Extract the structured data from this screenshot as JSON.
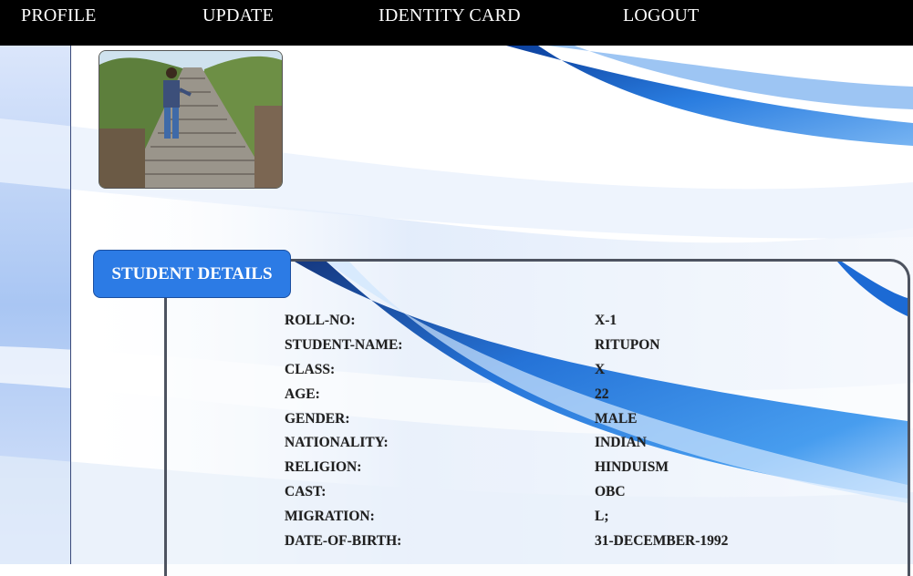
{
  "nav": {
    "profile": "PROFILE",
    "update": "UPDATE",
    "identity_card": "IDENTITY CARD",
    "logout": "LOGOUT"
  },
  "section_title": "STUDENT DETAILS",
  "details": [
    {
      "label": "ROLL-NO:",
      "value": "X-1"
    },
    {
      "label": "STUDENT-NAME:",
      "value": "RITUPON"
    },
    {
      "label": "CLASS:",
      "value": "X"
    },
    {
      "label": "AGE:",
      "value": "22"
    },
    {
      "label": "GENDER:",
      "value": "MALE"
    },
    {
      "label": "NATIONALITY:",
      "value": "INDIAN"
    },
    {
      "label": "RELIGION:",
      "value": "HINDUISM"
    },
    {
      "label": "CAST:",
      "value": "OBC"
    },
    {
      "label": "MIGRATION:",
      "value": "L;"
    },
    {
      "label": "DATE-OF-BIRTH:",
      "value": "31-DECEMBER-1992"
    }
  ],
  "colors": {
    "nav_bg": "#000000",
    "accent": "#2c7be5",
    "swoosh": "#1a6fd8"
  }
}
